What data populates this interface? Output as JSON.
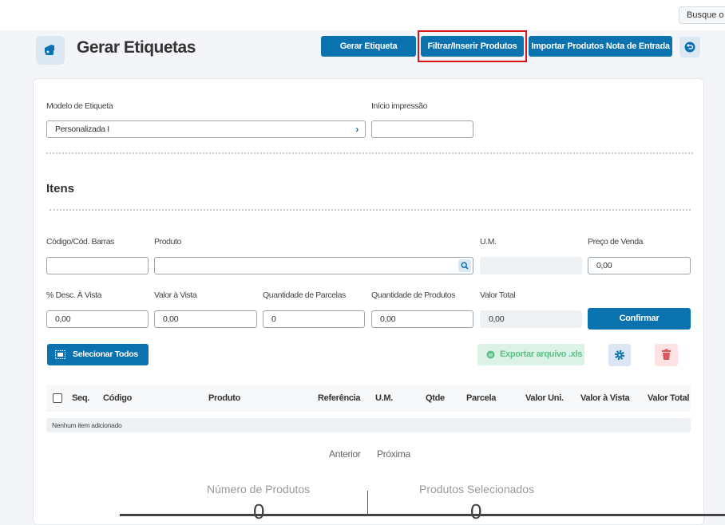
{
  "topbar": {
    "search_placeholder": "Busque o c"
  },
  "header": {
    "title": "Gerar Etiquetas",
    "buttons": {
      "gerar": "Gerar Etiqueta",
      "filtrar": "Filtrar/Inserir Produtos",
      "importar": "Importar Produtos Nota de Entrada"
    }
  },
  "form": {
    "modelo_label": "Modelo de Etiqueta",
    "modelo_value": "Personalizada I",
    "inicio_label": "Início impressão",
    "inicio_value": ""
  },
  "itens": {
    "title": "Itens",
    "codigo_label": "Código/Cód. Barras",
    "produto_label": "Produto",
    "um_label": "U.M.",
    "preco_label": "Preço de Venda",
    "preco_value": "0,00",
    "desc_label": "% Desc. À Vista",
    "desc_value": "0,00",
    "valor_vista_label": "Valor à Vista",
    "valor_vista_value": "0,00",
    "parcelas_label": "Quantidade de Parcelas",
    "parcelas_value": "0",
    "qtd_produtos_label": "Quantidade de Produtos",
    "qtd_produtos_value": "0,00",
    "valor_total_label": "Valor Total",
    "valor_total_value": "0,00",
    "confirmar": "Confirmar"
  },
  "actions": {
    "selecionar_todos": "Selecionar Todos",
    "exportar": "Exportar arquivo .xls"
  },
  "table": {
    "columns": [
      "Seq.",
      "Código",
      "Produto",
      "Referência",
      "U.M.",
      "Qtde",
      "Parcela",
      "Valor Uni.",
      "Valor à Vista",
      "Valor Total"
    ],
    "empty": "Nenhum item adicionado"
  },
  "pager": {
    "prev": "Anterior",
    "next": "Próxima"
  },
  "stats": {
    "numero_label": "Número de Produtos",
    "numero_value": "0",
    "selecionados_label": "Produtos Selecionados",
    "selecionados_value": "0"
  },
  "colors": {
    "primary": "#0b72b0",
    "highlight": "#d9141a",
    "export_text": "#5cc189",
    "danger": "#e05555"
  }
}
